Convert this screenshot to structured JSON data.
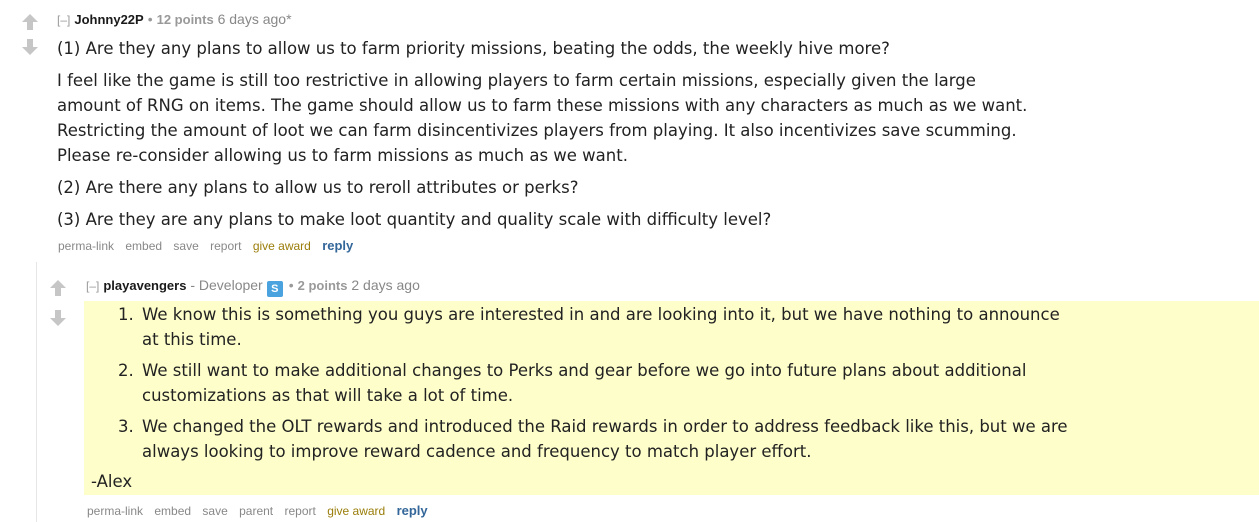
{
  "comment1": {
    "collapse": "[–]",
    "author": "Johnny22P",
    "score": "12 points",
    "time": "6 days ago*",
    "paragraphs": [
      "(1) Are they any plans to allow us to farm priority missions, beating the odds, the weekly hive more?",
      "I feel like the game is still too restrictive in allowing players to farm certain missions, especially given the large",
      "amount of RNG on items. The game should allow us to farm these missions with any characters as much as we want.",
      "Restricting the amount of loot we can farm disincentivizes players from playing. It also incentivizes save scumming.",
      "Please re-consider allowing us to farm missions as much as we want.",
      "(2) Are there any plans to allow us to reroll attributes or perks?",
      "(3) Are they are any plans to make loot quantity and quality scale with difficulty level?"
    ],
    "buttons": {
      "permalink": "perma-link",
      "embed": "embed",
      "save": "save",
      "report": "report",
      "give_award": "give award",
      "reply": "reply"
    }
  },
  "comment2": {
    "collapse": "[–]",
    "author": "playavengers",
    "separator": "-",
    "flair": "Developer",
    "badge": "S",
    "score": "2 points",
    "time": "2 days ago",
    "items": [
      {
        "num": "1.",
        "line1": "We know this is something you guys are interested in and are looking into it, but we have nothing to announce",
        "line2": "at this time."
      },
      {
        "num": "2.",
        "line1": "We still want to make additional changes to Perks and gear before we go into future plans about additional",
        "line2": "customizations as that will take a lot of time."
      },
      {
        "num": "3.",
        "line1": "We changed the OLT rewards and introduced the Raid rewards in order to address feedback like this, but we are",
        "line2": "always looking to improve reward cadence and frequency to match player effort."
      }
    ],
    "signoff": "-Alex",
    "buttons": {
      "permalink": "perma-link",
      "embed": "embed",
      "save": "save",
      "parent": "parent",
      "report": "report",
      "give_award": "give award",
      "reply": "reply"
    }
  },
  "colors": {
    "highlight": "#fefecb",
    "reply": "#336699",
    "gold": "#9a7d0a",
    "badge": "#4aa3df"
  }
}
